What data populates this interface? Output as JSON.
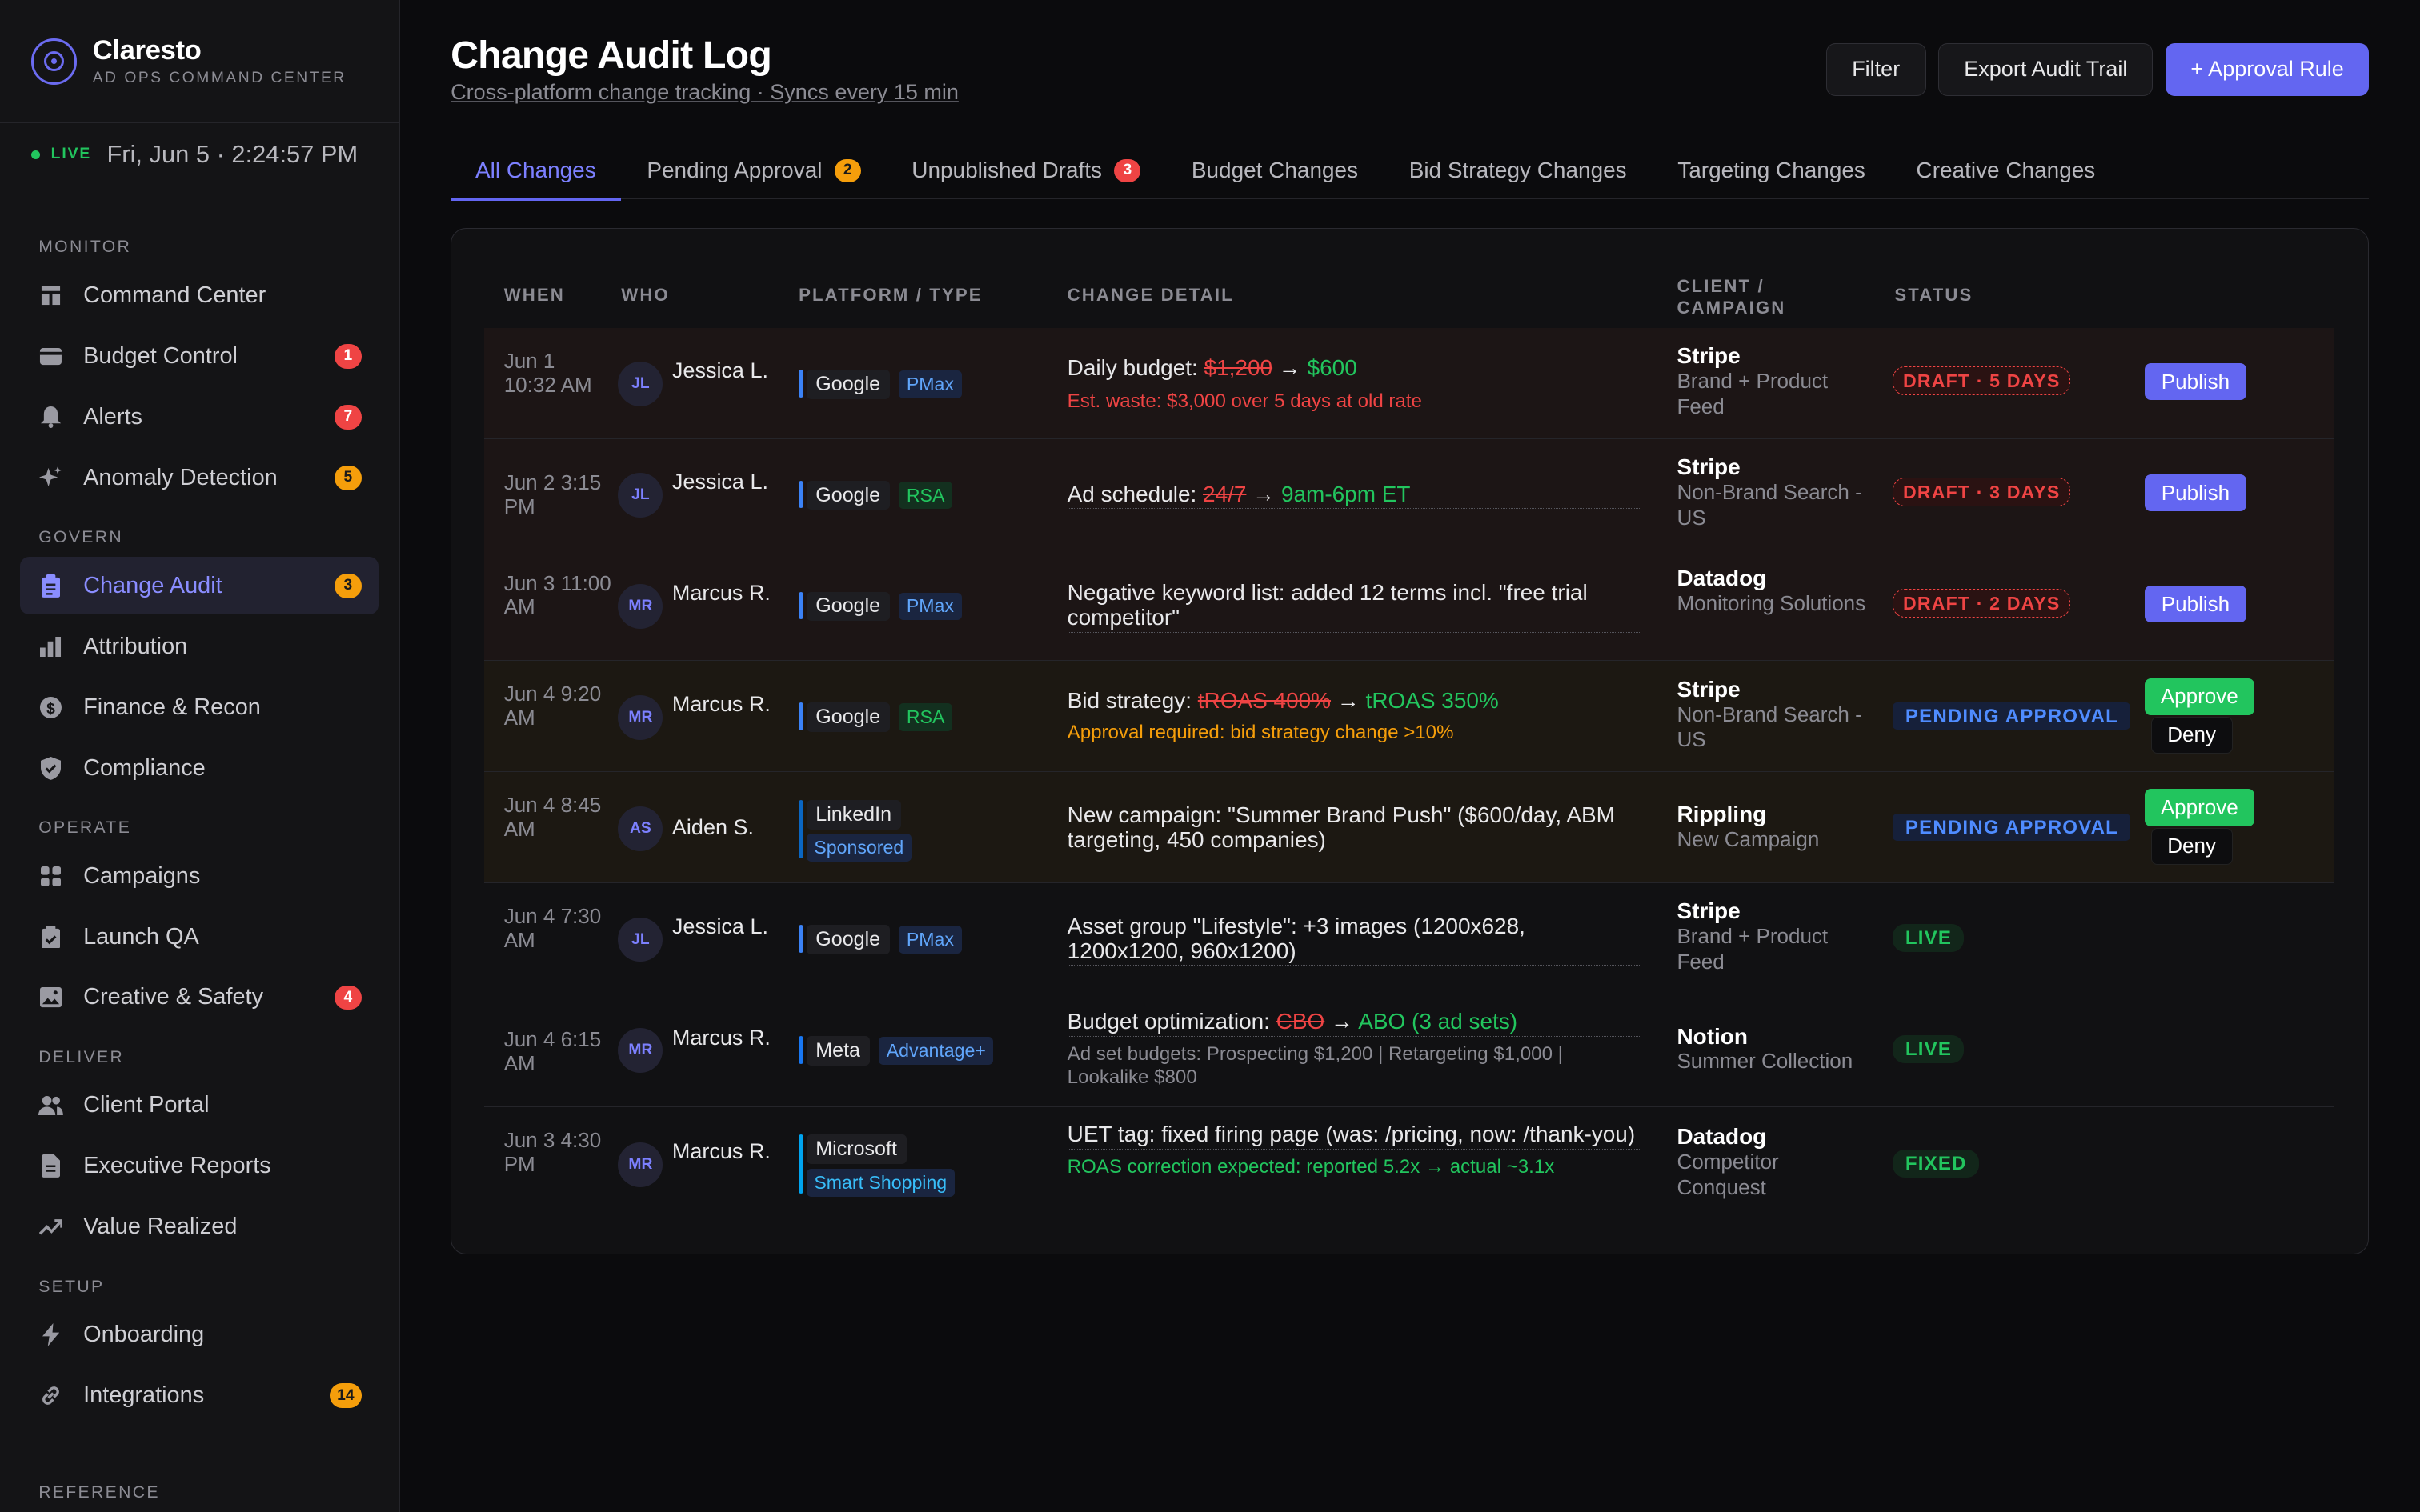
{
  "brand": {
    "name": "Claresto",
    "subtitle": "AD OPS COMMAND CENTER"
  },
  "clock": {
    "live": "LIVE",
    "time": "Fri, Jun 5 · 2:24:57 PM"
  },
  "sidebar": {
    "monitor": "MONITOR",
    "govern": "GOVERN",
    "operate": "OPERATE",
    "deliver": "DELIVER",
    "setup": "SETUP",
    "reference": "REFERENCE",
    "items": [
      {
        "label": "Command Center",
        "icon": "dashboard-icon",
        "badge": ""
      },
      {
        "label": "Budget Control",
        "icon": "credit-card-icon",
        "badge": "1"
      },
      {
        "label": "Alerts",
        "icon": "bell-icon",
        "badge": "7"
      },
      {
        "label": "Anomaly Detection",
        "icon": "sparkle-icon",
        "badge": "5"
      },
      {
        "label": "Change Audit",
        "icon": "clipboard-icon",
        "badge": "3"
      },
      {
        "label": "Attribution",
        "icon": "bar-chart-icon",
        "badge": ""
      },
      {
        "label": "Finance & Recon",
        "icon": "dollar-icon",
        "badge": ""
      },
      {
        "label": "Compliance",
        "icon": "shield-icon",
        "badge": ""
      },
      {
        "label": "Campaigns",
        "icon": "grid-icon",
        "badge": ""
      },
      {
        "label": "Launch QA",
        "icon": "checklist-icon",
        "badge": ""
      },
      {
        "label": "Creative & Safety",
        "icon": "image-icon",
        "badge": "4"
      },
      {
        "label": "Client Portal",
        "icon": "users-icon",
        "badge": ""
      },
      {
        "label": "Executive Reports",
        "icon": "document-icon",
        "badge": ""
      },
      {
        "label": "Value Realized",
        "icon": "trend-up-icon",
        "badge": ""
      },
      {
        "label": "Onboarding",
        "icon": "bolt-icon",
        "badge": ""
      },
      {
        "label": "Integrations",
        "icon": "link-icon",
        "badge": "14"
      }
    ]
  },
  "header": {
    "title": "Change Audit Log",
    "subtitle": "Cross-platform change tracking · Syncs every 15 min",
    "filter": "Filter",
    "export": "Export Audit Trail",
    "approval_rule": "+ Approval Rule"
  },
  "tabs": [
    {
      "label": "All Changes",
      "badge": ""
    },
    {
      "label": "Pending Approval",
      "badge": "2"
    },
    {
      "label": "Unpublished Drafts",
      "badge": "3"
    },
    {
      "label": "Budget Changes",
      "badge": ""
    },
    {
      "label": "Bid Strategy Changes",
      "badge": ""
    },
    {
      "label": "Targeting Changes",
      "badge": ""
    },
    {
      "label": "Creative Changes",
      "badge": ""
    }
  ],
  "table": {
    "columns": {
      "when": "WHEN",
      "who": "WHO",
      "platform": "PLATFORM / TYPE",
      "detail": "CHANGE DETAIL",
      "client1": "CLIENT /",
      "client2": "CAMPAIGN",
      "status": "STATUS"
    },
    "rows": [
      {
        "when": "Jun 1 10:32 AM",
        "initials": "JL",
        "who": "Jessica L.",
        "platform": "Google",
        "type": "PMax",
        "detail_prefix": "Daily budget: ",
        "old": "$1,200",
        "arrow": "→",
        "new": "$600",
        "note": "Est. waste: $3,000 over 5 days at old rate",
        "client": "Stripe",
        "campaign": "Brand + Product Feed",
        "status": "DRAFT · 5 DAYS",
        "action": "Publish"
      },
      {
        "when": "Jun 2 3:15 PM",
        "initials": "JL",
        "who": "Jessica L.",
        "platform": "Google",
        "type": "RSA",
        "detail_prefix": "Ad schedule: ",
        "old": "24/7",
        "arrow": "→",
        "new": "9am-6pm ET",
        "note": "",
        "client": "Stripe",
        "campaign": "Non-Brand Search - US",
        "status": "DRAFT · 3 DAYS",
        "action": "Publish"
      },
      {
        "when": "Jun 3 11:00 AM",
        "initials": "MR",
        "who": "Marcus R.",
        "platform": "Google",
        "type": "PMax",
        "detail": "Negative keyword list: added 12 terms incl. \"free trial competitor\"",
        "client": "Datadog",
        "campaign": "Monitoring Solutions",
        "status": "DRAFT · 2 DAYS",
        "action": "Publish"
      },
      {
        "when": "Jun 4 9:20 AM",
        "initials": "MR",
        "who": "Marcus R.",
        "platform": "Google",
        "type": "RSA",
        "detail_prefix": "Bid strategy: ",
        "old": "tROAS 400%",
        "arrow": "→",
        "new": "tROAS 350%",
        "note": "Approval required: bid strategy change >10%",
        "client": "Stripe",
        "campaign": "Non-Brand Search - US",
        "status": "PENDING APPROVAL",
        "approve": "Approve",
        "deny": "Deny"
      },
      {
        "when": "Jun 4 8:45 AM",
        "initials": "AS",
        "who": "Aiden S.",
        "platform": "LinkedIn",
        "type": "Sponsored",
        "detail": "New campaign: \"Summer Brand Push\" ($600/day, ABM targeting, 450 companies)",
        "client": "Rippling",
        "campaign": "New Campaign",
        "status": "PENDING APPROVAL",
        "approve": "Approve",
        "deny": "Deny"
      },
      {
        "when": "Jun 4 7:30 AM",
        "initials": "JL",
        "who": "Jessica L.",
        "platform": "Google",
        "type": "PMax",
        "detail": "Asset group \"Lifestyle\": +3 images (1200x628, 1200x1200, 960x1200)",
        "client": "Stripe",
        "campaign": "Brand + Product Feed",
        "status": "LIVE"
      },
      {
        "when": "Jun 4 6:15 AM",
        "initials": "MR",
        "who": "Marcus R.",
        "platform": "Meta",
        "type": "Advantage+",
        "detail_prefix": "Budget optimization: ",
        "old": "CBO",
        "arrow": "→",
        "new": "ABO (3 ad sets)",
        "note": "Ad set budgets: Prospecting $1,200 | Retargeting $1,000 | Lookalike $800",
        "client": "Notion",
        "campaign": "Summer Collection",
        "status": "LIVE"
      },
      {
        "when": "Jun 3 4:30 PM",
        "initials": "MR",
        "who": "Marcus R.",
        "platform": "Microsoft",
        "type": "Smart Shopping",
        "detail": "UET tag: fixed firing page (was: /pricing, now: /thank-you)",
        "note": "ROAS correction expected: reported 5.2x → actual ~3.1x",
        "client": "Datadog",
        "campaign": "Competitor Conquest",
        "status": "FIXED"
      }
    ]
  },
  "colors": {
    "accent": "#6366f1",
    "draft": "#ef4444",
    "pending": "#4f8cff",
    "live": "#22c55e",
    "warning": "#f59e0b"
  }
}
